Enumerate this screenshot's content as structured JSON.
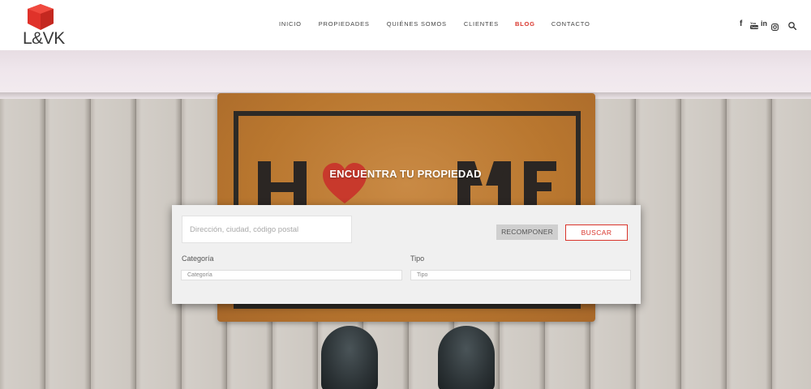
{
  "brand": {
    "name": "L&VK",
    "cube_color": "#e0322a"
  },
  "nav": {
    "items": [
      {
        "label": "INICIO"
      },
      {
        "label": "PROPIEDADES"
      },
      {
        "label": "QUIÉNES SOMOS"
      },
      {
        "label": "CLIENTES"
      },
      {
        "label": "BLOG",
        "active": true
      },
      {
        "label": "CONTACTO"
      }
    ],
    "active_color": "#d9342b"
  },
  "social": {
    "icons": [
      "facebook-icon",
      "youtube-icon",
      "linkedin-icon",
      "instagram-icon",
      "search-icon"
    ],
    "facebook": "f",
    "youtube": "▶",
    "linkedin": "in"
  },
  "hero": {
    "title": "ENCUENTRA TU PROPIEDAD"
  },
  "search": {
    "placeholder": "Dirección, ciudad, código postal",
    "reset_label": "RECOMPONER",
    "search_label": "BUSCAR",
    "category_label": "Categoría",
    "category_value": "Categoría",
    "type_label": "Tipo",
    "type_value": "Tipo"
  }
}
